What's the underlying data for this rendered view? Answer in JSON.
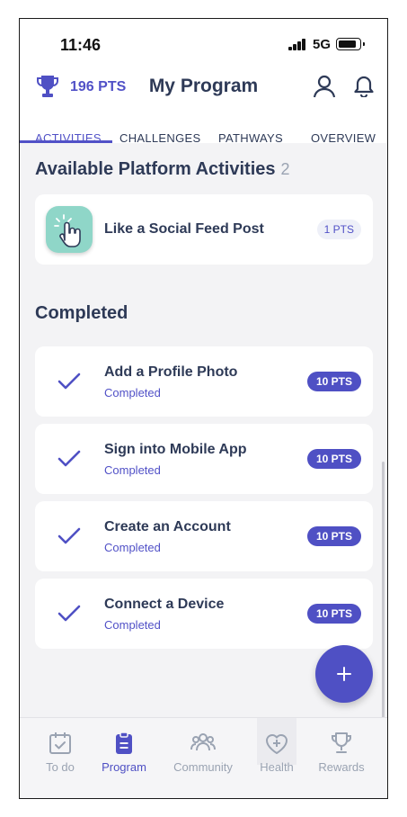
{
  "status_bar": {
    "time": "11:46",
    "network": "5G"
  },
  "header": {
    "points": "196 PTS",
    "title": "My Program",
    "tabs": [
      "ACTIVITIES",
      "CHALLENGES",
      "PATHWAYS",
      "OVERVIEW"
    ],
    "active_tab": "ACTIVITIES"
  },
  "available": {
    "title": "Available Platform Activities",
    "count": "2",
    "items": [
      {
        "title": "Like a Social Feed Post",
        "points": "1 PTS",
        "icon": "tap-hand-icon"
      }
    ]
  },
  "completed": {
    "title": "Completed",
    "items": [
      {
        "title": "Add a Profile Photo",
        "status": "Completed",
        "points": "10 PTS"
      },
      {
        "title": "Sign into Mobile App",
        "status": "Completed",
        "points": "10 PTS"
      },
      {
        "title": "Create an Account",
        "status": "Completed",
        "points": "10 PTS"
      },
      {
        "title": "Connect a Device",
        "status": "Completed",
        "points": "10 PTS"
      }
    ]
  },
  "bottom_nav": {
    "items": [
      "To do",
      "Program",
      "Community",
      "Health",
      "Rewards"
    ],
    "active": "Program"
  },
  "colors": {
    "accent": "#4f50c4",
    "text": "#2e3a57",
    "muted": "#9aa3b2",
    "teal": "#8fd6c8"
  }
}
